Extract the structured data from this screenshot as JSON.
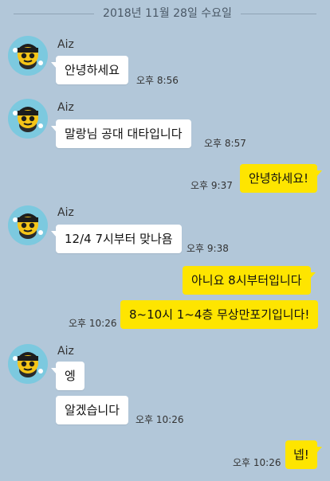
{
  "date_divider": "2018년 11월 28일 수요일",
  "colors": {
    "background": "#b2c7d9",
    "incoming_bubble": "#ffffff",
    "outgoing_bubble": "#fee500"
  },
  "messages": [
    {
      "sender": "Aiz",
      "text": "안녕하세요",
      "time": "오후 8:56",
      "direction": "incoming"
    },
    {
      "sender": "Aiz",
      "text": "말랑님 공대 대타입니다",
      "time": "오후 8:57",
      "direction": "incoming"
    },
    {
      "text": "안녕하세요!",
      "time": "오후 9:37",
      "direction": "outgoing"
    },
    {
      "sender": "Aiz",
      "text": "12/4 7시부터 맞나욤",
      "time": "오후 9:38",
      "direction": "incoming"
    },
    {
      "text": "아니요 8시부터입니다",
      "direction": "outgoing"
    },
    {
      "text": "8~10시 1~4층 무상만포기입니다!",
      "time": "오후 10:26",
      "direction": "outgoing"
    },
    {
      "sender": "Aiz",
      "text": "엥",
      "direction": "incoming"
    },
    {
      "text": "알겠습니다",
      "time": "오후 10:26",
      "direction": "incoming"
    },
    {
      "text": "넵!",
      "time": "오후 10:26",
      "direction": "outgoing"
    }
  ]
}
